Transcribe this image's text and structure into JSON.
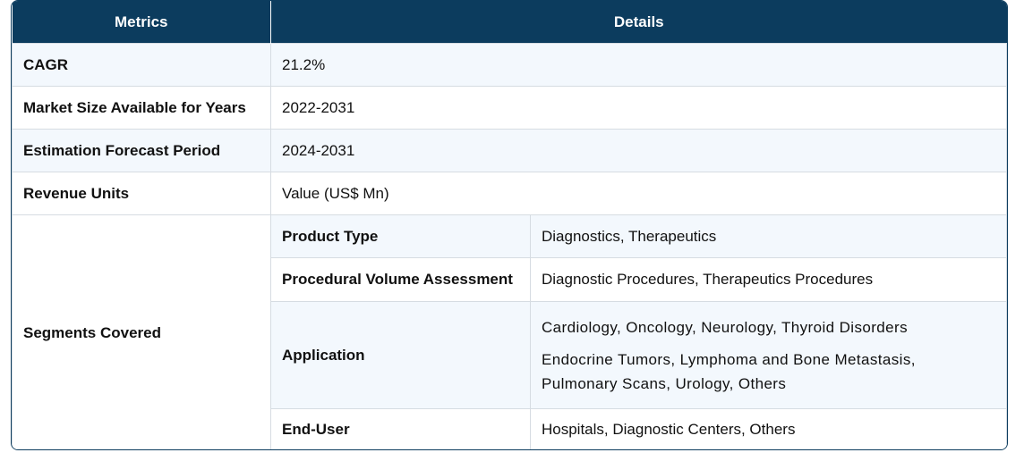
{
  "header": {
    "metrics": "Metrics",
    "details": "Details"
  },
  "rows": {
    "cagr": {
      "label": "CAGR",
      "value": "21.2%"
    },
    "market_size": {
      "label": "Market Size Available for Years",
      "value": "2022-2031"
    },
    "forecast": {
      "label": "Estimation Forecast Period",
      "value": "2024-2031"
    },
    "revenue": {
      "label": "Revenue Units",
      "value": "Value (US$ Mn)"
    }
  },
  "segments": {
    "label": "Segments Covered",
    "product_type": {
      "label": "Product Type",
      "value": "Diagnostics, Therapeutics"
    },
    "procedural": {
      "label": "Procedural Volume Assessment",
      "value": "Diagnostic Procedures, Therapeutics Procedures"
    },
    "application": {
      "label": "Application",
      "line1": "Cardiology, Oncology, Neurology, Thyroid Disorders",
      "line2": "Endocrine Tumors, Lymphoma and Bone Metastasis,",
      "line3": "Pulmonary Scans, Urology, Others"
    },
    "end_user": {
      "label": "End-User",
      "value": "Hospitals, Diagnostic Centers, Others"
    }
  }
}
